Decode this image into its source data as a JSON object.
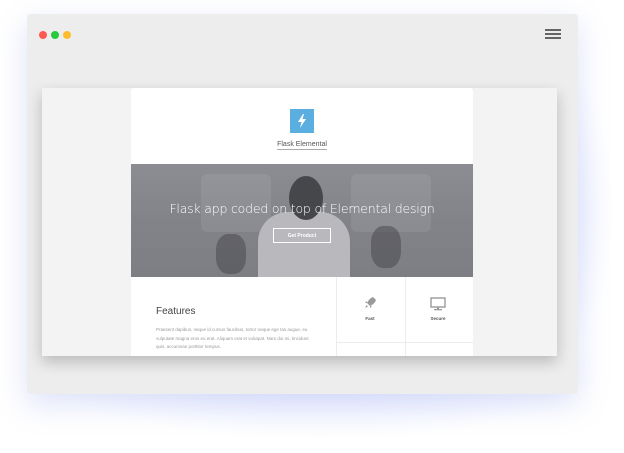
{
  "window": {
    "controls": [
      "close",
      "minimize",
      "maximize"
    ],
    "menu_icon": "hamburger-menu-icon"
  },
  "site": {
    "brand": "Flask Elemental",
    "logo_icon": "lightning-bolt-icon",
    "accent_color": "#5aaee0"
  },
  "hero": {
    "title": "Flask app coded on top of Elemental design",
    "button_label": "Get Product"
  },
  "features": {
    "heading": "Features",
    "body": "Praesent dapibus, neque id cursus faucibus, tortor neque ege tas augue, eu vulputate magna eros eu erat. Aliquam erat et volutpat. Nam dui mi, tincidunt quis, accumsan porttitor tempus.",
    "items": [
      {
        "label": "Fast",
        "icon": "rocket-icon"
      },
      {
        "label": "Secure",
        "icon": "monitor-icon"
      }
    ]
  }
}
